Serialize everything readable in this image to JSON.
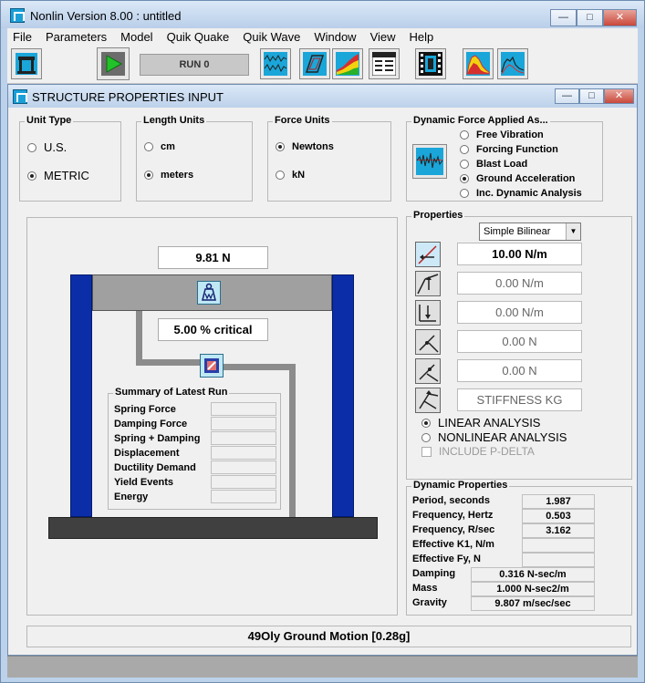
{
  "window": {
    "title": "Nonlin Version 8.00 : untitled"
  },
  "menu": [
    "File",
    "Parameters",
    "Model",
    "Quik Quake",
    "Quik Wave",
    "Window",
    "View",
    "Help"
  ],
  "toolbar": {
    "run_label": "RUN  0"
  },
  "child": {
    "title": "STRUCTURE PROPERTIES INPUT",
    "unit_type": {
      "label": "Unit Type",
      "options": [
        "U.S.",
        "METRIC"
      ],
      "selected": "METRIC"
    },
    "length_units": {
      "label": "Length Units",
      "options": [
        "cm",
        "meters"
      ],
      "selected": "meters"
    },
    "force_units": {
      "label": "Force Units",
      "options": [
        "Newtons",
        "kN"
      ],
      "selected": "Newtons"
    },
    "dynamic_force": {
      "label": "Dynamic Force Applied As...",
      "options": [
        "Free Vibration",
        "Forcing Function",
        "Blast Load",
        "Ground Acceleration",
        "Inc. Dynamic Analysis"
      ],
      "selected": "Ground Acceleration"
    },
    "structure": {
      "weight": "9.81 N",
      "damping": "5.00 % critical"
    },
    "summary": {
      "label": "Summary of Latest Run",
      "rows": [
        "Spring Force",
        "Damping Force",
        "Spring + Damping",
        "Displacement",
        "Ductility Demand",
        "Yield Events",
        "Energy"
      ]
    },
    "properties": {
      "label": "Properties",
      "model": "Simple Bilinear",
      "fields": [
        "10.00 N/m",
        "0.00 N/m",
        "0.00 N/m",
        "0.00 N",
        "0.00 N",
        "STIFFNESS KG"
      ],
      "analysis": [
        "LINEAR ANALYSIS",
        "NONLINEAR ANALYSIS"
      ],
      "selected_analysis": "LINEAR ANALYSIS",
      "pdelta": "INCLUDE P-DELTA"
    },
    "dynamic_properties": {
      "label": "Dynamic Properties",
      "rows": [
        {
          "name": "Period, seconds",
          "value": "1.987"
        },
        {
          "name": "Frequency, Hertz",
          "value": "0.503"
        },
        {
          "name": "Frequency, R/sec",
          "value": "3.162"
        },
        {
          "name": "Effective K1, N/m",
          "value": ""
        },
        {
          "name": "Effective Fy, N",
          "value": ""
        },
        {
          "name": "Damping",
          "value": "0.316 N-sec/m"
        },
        {
          "name": "Mass",
          "value": "1.000 N-sec2/m"
        },
        {
          "name": "Gravity",
          "value": "9.807 m/sec/sec"
        }
      ]
    },
    "status": "49Oly Ground Motion  [0.28g]"
  },
  "colors": {
    "column": "#0b2ea8",
    "beam": "#a0a0a0",
    "ground": "#404040",
    "titlebar": "#bcd1ea"
  }
}
